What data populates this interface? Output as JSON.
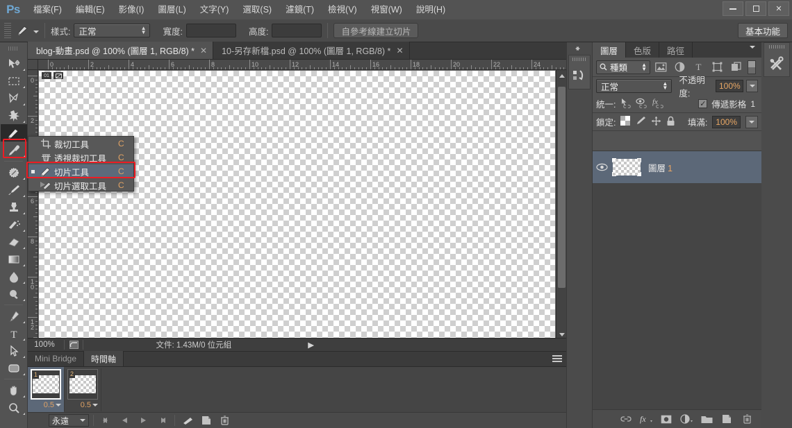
{
  "app": {
    "logo": "Ps",
    "menus": [
      {
        "label": "檔案(F)"
      },
      {
        "label": "編輯(E)"
      },
      {
        "label": "影像(I)"
      },
      {
        "label": "圖層(L)"
      },
      {
        "label": "文字(Y)"
      },
      {
        "label": "選取(S)"
      },
      {
        "label": "濾鏡(T)"
      },
      {
        "label": "檢視(V)"
      },
      {
        "label": "視窗(W)"
      },
      {
        "label": "說明(H)"
      }
    ],
    "window_buttons": {
      "minimize": "—",
      "maximize": "□",
      "close": "✕"
    }
  },
  "options_bar": {
    "tool_icon": "slice-tool-icon",
    "style_label": "樣式:",
    "style_value": "正常",
    "width_label": "寬度:",
    "width_value": "",
    "height_label": "高度:",
    "height_value": "",
    "slices_from_guides_label": "自參考線建立切片",
    "workspace_label": "基本功能"
  },
  "tabs": [
    {
      "label": "blog-動畫.psd @ 100% (圖層 1, RGB/8) *",
      "close": "✕",
      "active": true
    },
    {
      "label": "10-另存新檔.psd @ 100% (圖層 1, RGB/8) *",
      "close": "✕",
      "active": false
    }
  ],
  "toolbox": {
    "tools": [
      {
        "name": "move-tool",
        "selected": false
      },
      {
        "name": "rectangular-marquee-tool",
        "selected": false
      },
      {
        "name": "lasso-tool",
        "selected": false
      },
      {
        "name": "magic-wand-tool",
        "selected": false
      },
      {
        "name": "slice-tool",
        "selected": true
      },
      {
        "name": "eyedropper-tool",
        "selected": false
      },
      {
        "name": "spot-healing-brush-tool",
        "selected": false
      },
      {
        "name": "brush-tool",
        "selected": false
      },
      {
        "name": "clone-stamp-tool",
        "selected": false
      },
      {
        "name": "history-brush-tool",
        "selected": false
      },
      {
        "name": "eraser-tool",
        "selected": false
      },
      {
        "name": "gradient-tool",
        "selected": false
      },
      {
        "name": "blur-tool",
        "selected": false
      },
      {
        "name": "dodge-tool",
        "selected": false
      },
      {
        "name": "pen-tool",
        "selected": false
      },
      {
        "name": "type-tool",
        "selected": false
      },
      {
        "name": "path-selection-tool",
        "selected": false
      },
      {
        "name": "rectangle-tool",
        "selected": false
      },
      {
        "name": "hand-tool",
        "selected": false
      },
      {
        "name": "zoom-tool",
        "selected": false
      }
    ]
  },
  "flyout_menu": {
    "items": [
      {
        "icon": "crop-tool-icon",
        "label": "裁切工具",
        "shortcut": "C",
        "selected": false,
        "bullet": false
      },
      {
        "icon": "perspective-crop-tool-icon",
        "label": "透視裁切工具",
        "shortcut": "C",
        "selected": false,
        "bullet": false
      },
      {
        "icon": "slice-tool-icon",
        "label": "切片工具",
        "shortcut": "C",
        "selected": true,
        "bullet": true
      },
      {
        "icon": "slice-select-tool-icon",
        "label": "切片選取工具",
        "shortcut": "C",
        "selected": false,
        "bullet": false
      }
    ],
    "highlight_color": "#ed1c24"
  },
  "rulers": {
    "unit_hint": "cm",
    "horizontal_ticks": [
      "0",
      "2",
      "4",
      "6",
      "8",
      "10",
      "12",
      "14",
      "16",
      "18",
      "20",
      "22",
      "24"
    ],
    "vertical_ticks": [
      "0",
      "2",
      "4",
      "6",
      "8",
      "10",
      "12"
    ]
  },
  "canvas": {
    "badge_left": "01",
    "badge_right": "slice-icon"
  },
  "status_bar": {
    "zoom": "100%",
    "preview_icon": "document-preview-icon",
    "doc_info": "文件: 1.43M/0 位元組",
    "play_icon": "▶"
  },
  "timeline": {
    "tabs": [
      {
        "label": "Mini Bridge",
        "active": false
      },
      {
        "label": "時間軸",
        "active": true
      }
    ],
    "frames": [
      {
        "number": "1",
        "delay": "0.5",
        "selected": true
      },
      {
        "number": "2",
        "delay": "0.5",
        "selected": false
      }
    ],
    "loop_value": "永遠",
    "controls": [
      {
        "name": "select-first-frame-button",
        "glyph": "◀◀"
      },
      {
        "name": "previous-frame-button",
        "glyph": "◀"
      },
      {
        "name": "play-animation-button",
        "glyph": "▶"
      },
      {
        "name": "next-frame-button",
        "glyph": "▶▶"
      },
      {
        "name": "tween-frames-button",
        "glyph": "tween-icon"
      },
      {
        "name": "duplicate-frame-button",
        "glyph": "duplicate-icon"
      },
      {
        "name": "delete-frame-button",
        "glyph": "trash-icon"
      }
    ]
  },
  "mini_dock": {
    "collapse_icon": "collapse-left-icon",
    "panels": [
      {
        "name": "history-panel-icon"
      }
    ]
  },
  "layers_panel": {
    "tabs": [
      {
        "label": "圖層",
        "active": true
      },
      {
        "label": "色版",
        "active": false
      },
      {
        "label": "路徑",
        "active": false
      }
    ],
    "filter": {
      "search_icon": "search-icon",
      "kind_label": "種類",
      "icons": [
        {
          "name": "filter-pixel-icon"
        },
        {
          "name": "filter-adjustment-icon"
        },
        {
          "name": "filter-type-icon"
        },
        {
          "name": "filter-shape-icon"
        },
        {
          "name": "filter-smart-object-icon"
        }
      ],
      "toggle": "filter-enable-toggle"
    },
    "blend_mode": "正常",
    "opacity_label": "不透明度:",
    "opacity_value": "100%",
    "unify_label": "統一:",
    "unify_icons": [
      {
        "name": "unify-position-icon"
      },
      {
        "name": "unify-visibility-icon"
      },
      {
        "name": "unify-style-icon"
      }
    ],
    "propagate_label": "傳遞影格",
    "propagate_count": "1",
    "propagate_checked": true,
    "lock_label": "鎖定:",
    "lock_icons": [
      {
        "name": "lock-transparent-pixels-icon"
      },
      {
        "name": "lock-image-pixels-icon"
      },
      {
        "name": "lock-position-icon"
      },
      {
        "name": "lock-all-icon"
      }
    ],
    "fill_label": "填滿:",
    "fill_value": "100%",
    "layers": [
      {
        "name": "圖層",
        "index": "1",
        "visible": true,
        "selected": true
      }
    ],
    "footer_buttons": [
      {
        "name": "link-layers-button",
        "glyph": "link-icon"
      },
      {
        "name": "layer-style-button",
        "glyph": "fx-icon"
      },
      {
        "name": "layer-mask-button",
        "glyph": "mask-icon"
      },
      {
        "name": "adjustment-layer-button",
        "glyph": "adjustment-icon"
      },
      {
        "name": "new-group-button",
        "glyph": "folder-icon"
      },
      {
        "name": "new-layer-button",
        "glyph": "new-layer-icon"
      },
      {
        "name": "delete-layer-button",
        "glyph": "trash-icon"
      }
    ]
  },
  "right_strip": {
    "panels": [
      {
        "name": "tool-presets-panel-icon"
      }
    ]
  },
  "colors": {
    "accent_orange": "#e8a765",
    "selection_blue": "#5c6878",
    "highlight_red": "#ed1c24",
    "panel_bg": "#535353",
    "chrome_bg": "#4a4a4a"
  }
}
